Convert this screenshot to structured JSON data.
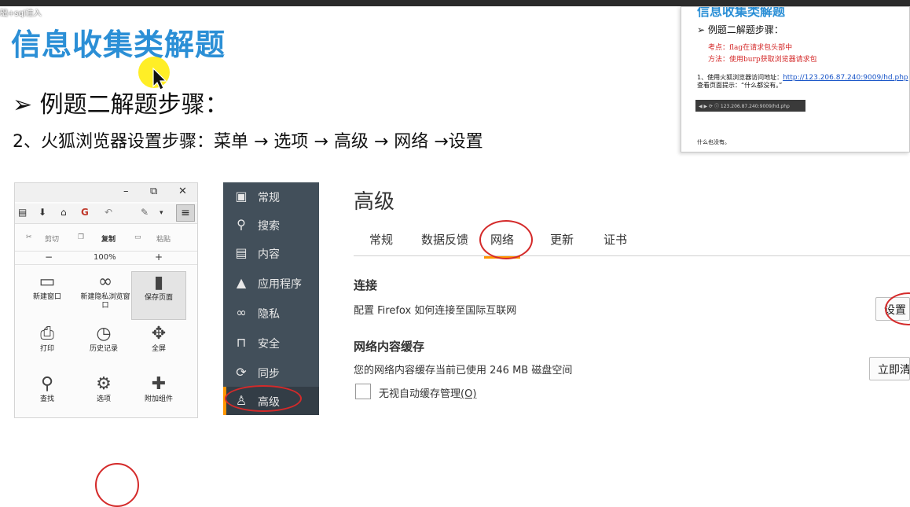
{
  "video": {
    "clip_title": "础+sql注入"
  },
  "slide": {
    "title": "信息收集类解题",
    "step_heading": "➢ 例题二解题步骤：",
    "step_line": "2、火狐浏览器设置步骤：菜单 → 选项 → 高级 → 网络 →设置"
  },
  "mini_slide": {
    "title": "信息收集类解题",
    "step_heading": "➢ 例题二解题步骤：",
    "point": "考点：flag在请求包头部中",
    "method": "方法：使用burp获取浏览器请求包",
    "line1_prefix": "1、使用火狐浏览器访问地址：",
    "line1_link": "http://123.206.87.240:9009/hd.php",
    "line2": "查看页面提示：“什么都没有。”",
    "url_bar": "123.206.87.240:9009/hd.php",
    "footer": "什么也没有。"
  },
  "firefox_menu": {
    "window_controls": [
      "–",
      "⧉",
      "✕"
    ],
    "cut": "剪切",
    "copy": "复制",
    "paste": "粘贴",
    "zoom_out": "−",
    "zoom": "100%",
    "zoom_in": "+",
    "tiles": [
      {
        "label": "新建窗口",
        "icon": "window-icon"
      },
      {
        "label": "新建隐私浏览窗口",
        "icon": "mask-icon"
      },
      {
        "label": "保存页面",
        "icon": "page-icon"
      },
      {
        "label": "打印",
        "icon": "printer-icon"
      },
      {
        "label": "历史记录",
        "icon": "clock-icon"
      },
      {
        "label": "全屏",
        "icon": "fullscreen-icon"
      },
      {
        "label": "查找",
        "icon": "magnifier-icon"
      },
      {
        "label": "选项",
        "icon": "gear-icon"
      },
      {
        "label": "附加组件",
        "icon": "puzzle-icon"
      }
    ]
  },
  "options": {
    "sidebar": [
      {
        "label": "常规",
        "icon": "general-icon"
      },
      {
        "label": "搜索",
        "icon": "search-icon"
      },
      {
        "label": "内容",
        "icon": "content-icon"
      },
      {
        "label": "应用程序",
        "icon": "rocket-icon"
      },
      {
        "label": "隐私",
        "icon": "mask-icon"
      },
      {
        "label": "安全",
        "icon": "lock-icon"
      },
      {
        "label": "同步",
        "icon": "sync-icon"
      },
      {
        "label": "高级",
        "icon": "wizard-icon"
      }
    ],
    "title": "高级",
    "tabs": [
      "常规",
      "数据反馈",
      "网络",
      "更新",
      "证书"
    ],
    "connection_heading": "连接",
    "connection_text": "配置 Firefox 如何连接至国际互联网",
    "settings_button": "设置",
    "cache_heading": "网络内容缓存",
    "cache_text": "您的网络内容缓存当前已使用 246 MB 磁盘空间",
    "clear_button": "立即清",
    "override_label": "无视自动缓存管理",
    "override_key": "(O)"
  },
  "colors": {
    "accent": "#ff9500",
    "title_blue": "#2b8fd6",
    "annotation_red": "#d42a2a",
    "sidebar": "#424f5a"
  }
}
